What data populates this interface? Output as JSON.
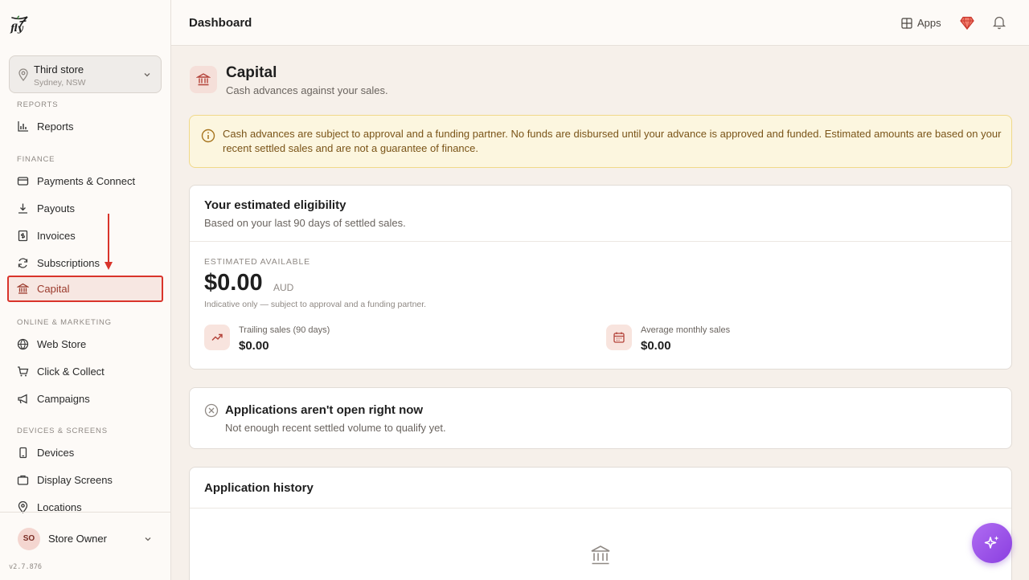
{
  "app": {
    "logo_text": "fly",
    "version": "v2.7.876"
  },
  "store": {
    "name": "Third store",
    "location": "Sydney, NSW"
  },
  "sidebar": {
    "sections": {
      "reports": "REPORTS",
      "finance": "FINANCE",
      "online": "ONLINE & MARKETING",
      "devices": "DEVICES & SCREENS"
    },
    "items": {
      "reports": "Reports",
      "payments": "Payments & Connect",
      "payouts": "Payouts",
      "invoices": "Invoices",
      "subscriptions": "Subscriptions",
      "capital": "Capital",
      "webstore": "Web Store",
      "clickcollect": "Click & Collect",
      "campaigns": "Campaigns",
      "devices": "Devices",
      "displayscreens": "Display Screens",
      "locations": "Locations"
    },
    "active_item": "capital",
    "user": {
      "initials": "SO",
      "name": "Store Owner"
    }
  },
  "topbar": {
    "title": "Dashboard",
    "apps_label": "Apps"
  },
  "page": {
    "title": "Capital",
    "subtitle": "Cash advances against your sales.",
    "notice": "Cash advances are subject to approval and a funding partner. No funds are disbursed until your advance is approved and funded. Estimated amounts are based on your recent settled sales and are not a guarantee of finance.",
    "eligibility": {
      "title": "Your estimated eligibility",
      "subtitle": "Based on your last 90 days of settled sales.",
      "estimated_label": "ESTIMATED AVAILABLE",
      "amount": "$0.00",
      "currency": "AUD",
      "indicative": "Indicative only — subject to approval and a funding partner.",
      "trailing_label": "Trailing sales (90 days)",
      "trailing_value": "$0.00",
      "monthly_label": "Average monthly sales",
      "monthly_value": "$0.00"
    },
    "status": {
      "title": "Applications aren't open right now",
      "subtitle": "Not enough recent settled volume to qualify yet."
    },
    "history": {
      "title": "Application history"
    }
  },
  "colors": {
    "accent": "#d9342b",
    "brand_red": "#b4433a",
    "fab": "#9b51e0",
    "notice_bg": "#fcf6df"
  }
}
